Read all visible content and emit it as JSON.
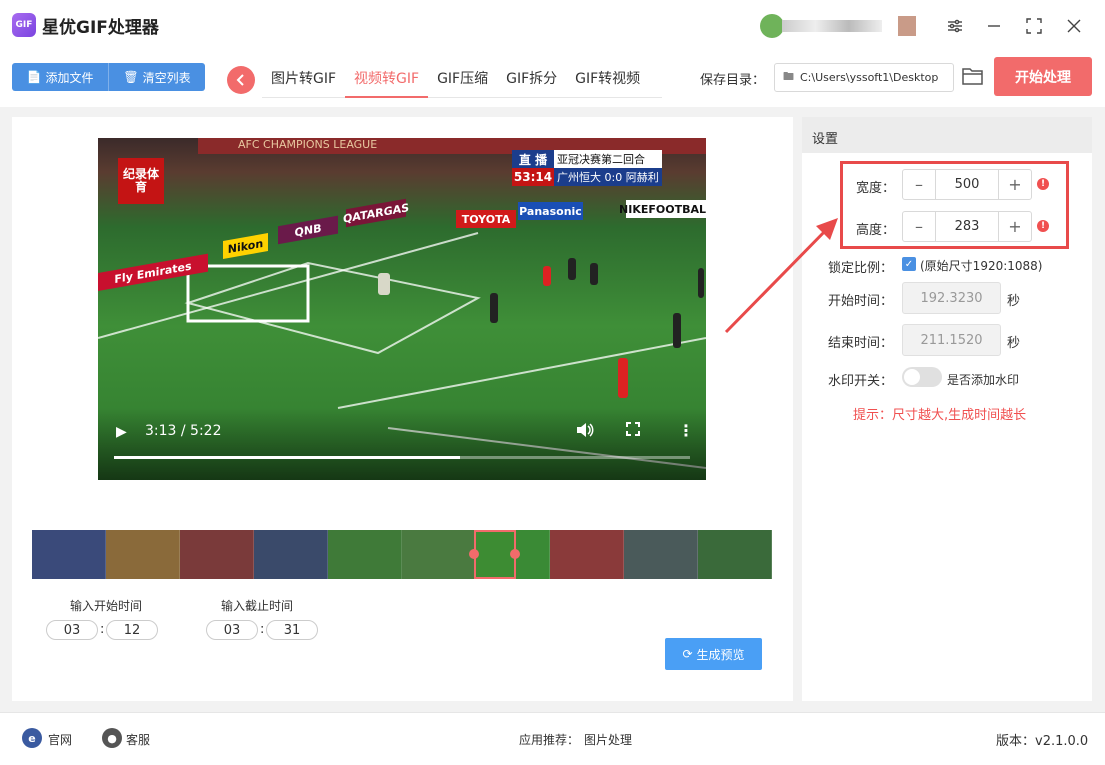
{
  "app": {
    "title": "星优GIF处理器",
    "logo_text": "GIF"
  },
  "toolbar": {
    "add_files_label": "添加文件",
    "clear_list_label": "清空列表",
    "tabs": [
      {
        "label": "图片转GIF",
        "active": false
      },
      {
        "label": "视频转GIF",
        "active": true
      },
      {
        "label": "GIF压缩",
        "active": false
      },
      {
        "label": "GIF拆分",
        "active": false
      },
      {
        "label": "GIF转视频",
        "active": false
      }
    ],
    "save_dir_label": "保存目录：",
    "save_dir_value": "C:\\Users\\yssoft1\\Desktop",
    "start_label": "开始处理"
  },
  "video": {
    "time_display": "3:13 / 5:22",
    "progress": 0.6,
    "overlay_logo": "纪录体育",
    "scoreboard": {
      "live": "直 播",
      "title": "亚冠决赛第二回合",
      "clock": "53:14",
      "teams": "广州恒大 0:0 阿赫利"
    },
    "banner_text": "AFC CHAMPIONS LEAGUE",
    "ads": [
      "Fly Emirates",
      "Nikon",
      "QNB",
      "QATARGAS",
      "TOYOTA",
      "Panasonic",
      "NIKEFOOTBALL"
    ]
  },
  "trim": {
    "start_label": "输入开始时间",
    "end_label": "输入截止时间",
    "start_min": "03",
    "start_sec": "12",
    "end_min": "03",
    "end_sec": "31",
    "colon": ":",
    "preview_label": "生成预览"
  },
  "settings": {
    "header": "设置",
    "width_label": "宽度：",
    "width_value": "500",
    "height_label": "高度：",
    "height_value": "283",
    "lock_label": "锁定比例：",
    "lock_checked": true,
    "lock_note": "(原始尺寸1920:1088)",
    "start_time_label": "开始时间：",
    "start_time_value": "192.3230",
    "end_time_label": "结束时间：",
    "end_time_value": "211.1520",
    "sec_unit": "秒",
    "watermark_label": "水印开关：",
    "watermark_note": "是否添加水印",
    "watermark_on": false,
    "tip": "提示：尺寸越大,生成时间越长"
  },
  "footer": {
    "website": "官网",
    "support": "客服",
    "recommend_label": "应用推荐：",
    "recommend_value": "图片处理",
    "version": "版本：v2.1.0.0"
  },
  "colors": {
    "accent": "#f26b6b",
    "primary": "#4a90e2",
    "warning": "#f05050"
  }
}
